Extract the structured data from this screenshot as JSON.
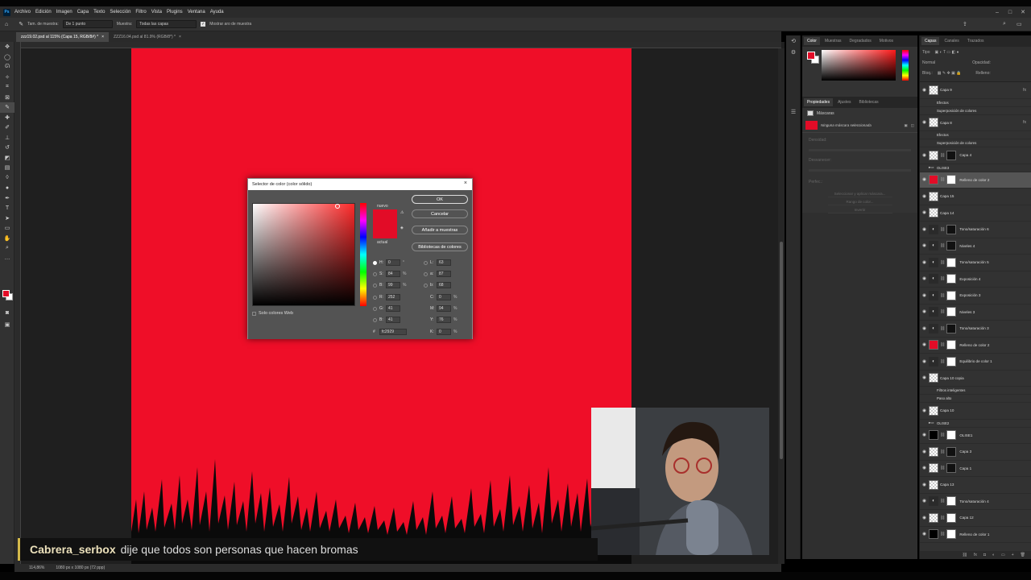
{
  "menu": [
    "Archivo",
    "Edición",
    "Imagen",
    "Capa",
    "Texto",
    "Selección",
    "Filtro",
    "Vista",
    "Plugins",
    "Ventana",
    "Ayuda"
  ],
  "app_icon": "Ps",
  "options": {
    "sample_size_label": "Tam. de muestra:",
    "sample_size_value": "De 1 punto",
    "sample_label": "Muestra:",
    "sample_value": "Todas las capas",
    "show_ring_label": "Mostrar aro de muestra"
  },
  "tabs": [
    {
      "label": "zzz19.02.psd al 115% (Capa 15, RGB/8#) *",
      "close": "×"
    },
    {
      "label": "ZZZ16.04.psd al 81.9% (RGB/8*) *",
      "close": "×"
    }
  ],
  "status": {
    "zoom": "114,86%",
    "size": "1080 px x 1080 px (72 ppp)"
  },
  "color_panel": {
    "tabs": [
      "Color",
      "Muestras",
      "Degradados",
      "Motivos"
    ]
  },
  "props_panel": {
    "tabs": [
      "Propiedades",
      "Ajustes",
      "Bibliotecas"
    ],
    "masks_label": "Máscaras",
    "no_mask": "Ninguna máscara seleccionada",
    "density": "Densidad:",
    "feather": "Desvanecer:",
    "refine": "Perfec.:",
    "select_mask": "Seleccionar y aplicar máscara...",
    "color_range": "Rango de color...",
    "invert": "Invertir"
  },
  "layers_panel": {
    "tabs": [
      "Capas",
      "Canales",
      "Trazados"
    ],
    "kind": "Tipo",
    "normal": "Normal",
    "opacity": "Opacidad:",
    "lock": "Bloq.:",
    "fill": "Relleno:"
  },
  "layers": [
    {
      "name": "Capa 9",
      "thumb": "ck",
      "fx": "fx"
    },
    {
      "name": "Efectos",
      "sub": true
    },
    {
      "name": "Superposición de colores",
      "sub": true
    },
    {
      "name": "Capa 8",
      "thumb": "ck",
      "fx": "fx"
    },
    {
      "name": "Efectos",
      "sub": true
    },
    {
      "name": "Superposición de colores",
      "sub": true
    },
    {
      "name": "Capa 4",
      "thumb": "ck",
      "mask": "bk"
    },
    {
      "name": "OLISE3",
      "thumb": "folder",
      "sub": true
    },
    {
      "name": "Relleno de color 2",
      "thumb": "rd",
      "mask": "wh",
      "sel": true
    },
    {
      "name": "Capa 15",
      "thumb": "ck"
    },
    {
      "name": "Capa 14",
      "thumb": "ck"
    },
    {
      "name": "Tono/saturación 6",
      "thumb": "adj",
      "mask": "bk"
    },
    {
      "name": "Niveles 4",
      "thumb": "adj",
      "mask": "bk"
    },
    {
      "name": "Tono/saturación 5",
      "thumb": "adj",
      "mask": "wh"
    },
    {
      "name": "Exposición 4",
      "thumb": "adj",
      "mask": "wh"
    },
    {
      "name": "Exposición 3",
      "thumb": "adj",
      "mask": "wh"
    },
    {
      "name": "Niveles 3",
      "thumb": "adj",
      "mask": "wh"
    },
    {
      "name": "Tono/saturación 3",
      "thumb": "adj",
      "mask": "bk"
    },
    {
      "name": "Relleno de color 2",
      "thumb": "rd",
      "mask": "wh"
    },
    {
      "name": "Equilibrio de color 1",
      "thumb": "adj",
      "mask": "wh"
    },
    {
      "name": "Capa 10 copia",
      "thumb": "ck"
    },
    {
      "name": "Filtros inteligentes",
      "sub": true
    },
    {
      "name": "Paso alto",
      "sub": true
    },
    {
      "name": "Capa 10",
      "thumb": "ck"
    },
    {
      "name": "OLISE2",
      "thumb": "folder",
      "sub": true
    },
    {
      "name": "OLISE1",
      "thumb": "bk",
      "mask": "wh"
    },
    {
      "name": "Capa 3",
      "thumb": "ck",
      "mask": "bk"
    },
    {
      "name": "Capa 1",
      "thumb": "ck",
      "mask": "bk"
    },
    {
      "name": "Capa 13",
      "thumb": "ck"
    },
    {
      "name": "Tono/saturación 4",
      "thumb": "adj",
      "mask": "wh"
    },
    {
      "name": "Capa 12",
      "thumb": "ck",
      "mask": "wh"
    },
    {
      "name": "Relleno de color 1",
      "thumb": "bk",
      "mask": "wh"
    }
  ],
  "dialog": {
    "title": "Selector de color (color sólido)",
    "close": "×",
    "new_label": "nuevo",
    "current_label": "actual",
    "ok": "OK",
    "cancel": "Cancelar",
    "add_swatch": "Añadir a muestras",
    "libraries": "Bibliotecas de colores",
    "web_only": "Solo colores Web",
    "new_color": "#e20c27",
    "H": "0",
    "S": "84",
    "B": "99",
    "R": "252",
    "G": "41",
    "Bv": "41",
    "L": "63",
    "a": "87",
    "b": "68",
    "C": "0",
    "M": "94",
    "Y": "76",
    "K": "0",
    "hex": "fc2929",
    "deg": "°",
    "pct": "%"
  },
  "chat": {
    "user": "Cabrera_serbox",
    "message": "dije que todos son personas que hacen bromas"
  }
}
